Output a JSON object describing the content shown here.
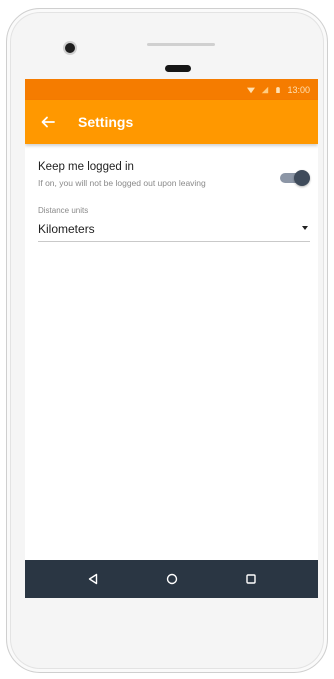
{
  "status_bar": {
    "time": "13:00",
    "icons": [
      "wifi-icon",
      "signal-icon",
      "battery-icon"
    ]
  },
  "app_bar": {
    "back_icon": "arrow-left-icon",
    "title": "Settings"
  },
  "settings": {
    "keep_logged_in": {
      "title": "Keep me logged in",
      "subtitle": "If on, you will not be logged out upon leaving",
      "enabled": true
    },
    "distance_units": {
      "label": "Distance units",
      "value": "Kilometers"
    }
  },
  "nav_bar": {
    "icons": [
      "back-triangle-icon",
      "home-circle-icon",
      "recents-square-icon"
    ]
  },
  "colors": {
    "status_bar": "#f57c00",
    "app_bar": "#ff9800",
    "nav_bar": "#2a3643",
    "toggle_thumb": "#3f4b5b",
    "toggle_track": "#8c96a6"
  }
}
